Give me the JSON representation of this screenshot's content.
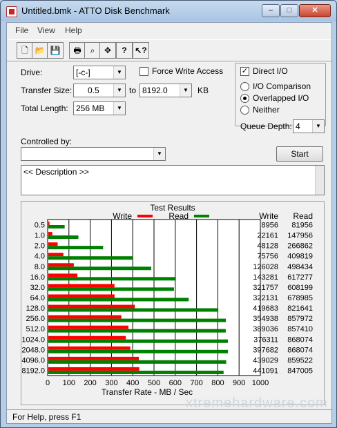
{
  "window": {
    "title": "Untitled.bmk - ATTO Disk Benchmark",
    "minimize": "–",
    "maximize": "□",
    "close": "✕"
  },
  "menu": [
    "File",
    "View",
    "Help"
  ],
  "toolbar": [
    "new-icon",
    "open-icon",
    "save-icon",
    "print-icon",
    "print-preview-icon",
    "move-icon",
    "help-icon",
    "context-help-icon"
  ],
  "form": {
    "drive_label": "Drive:",
    "drive_value": "[-c-]",
    "force_write_label": "Force Write Access",
    "force_write_checked": false,
    "direct_io_label": "Direct I/O",
    "direct_io_checked": true,
    "transfer_size_label": "Transfer Size:",
    "transfer_from": "0.5",
    "to_label": "to",
    "transfer_to": "8192.0",
    "kb_label": "KB",
    "total_length_label": "Total Length:",
    "total_length_value": "256 MB",
    "io_comparison_label": "I/O Comparison",
    "overlapped_io_label": "Overlapped I/O",
    "neither_label": "Neither",
    "selected_mode": "Overlapped I/O",
    "queue_depth_label": "Queue Depth:",
    "queue_depth_value": "4",
    "controlled_by_label": "Controlled by:",
    "controlled_by_value": "",
    "start_label": "Start",
    "description": "<< Description >>"
  },
  "status": "For Help, press F1",
  "watermark": "xtremehardware.com",
  "colors": {
    "write": "#ff0000",
    "read": "#008000",
    "accent": "#3d6aa2"
  },
  "chart_data": {
    "type": "bar",
    "title": "Test Results",
    "xlabel": "Transfer Rate - MB / Sec",
    "xlim": [
      0,
      1000
    ],
    "xticks": [
      0,
      100,
      200,
      300,
      400,
      500,
      600,
      700,
      800,
      900,
      1000
    ],
    "legend": [
      "Write",
      "Read"
    ],
    "col_headers": [
      "Write",
      "Read"
    ],
    "categories": [
      "0.5",
      "1.0",
      "2.0",
      "4.0",
      "8.0",
      "16.0",
      "32.0",
      "64.0",
      "128.0",
      "256.0",
      "512.0",
      "1024.0",
      "2048.0",
      "4096.0",
      "8192.0"
    ],
    "series": [
      {
        "name": "Write",
        "values": [
          8956,
          22161,
          48128,
          75756,
          126028,
          143281,
          321757,
          322131,
          419683,
          354938,
          389036,
          376311,
          397682,
          439029,
          441091
        ]
      },
      {
        "name": "Read",
        "values": [
          81956,
          147956,
          266862,
          409819,
          498434,
          617277,
          608199,
          678985,
          821641,
          857972,
          857410,
          868074,
          868074,
          859522,
          847005
        ]
      }
    ]
  }
}
